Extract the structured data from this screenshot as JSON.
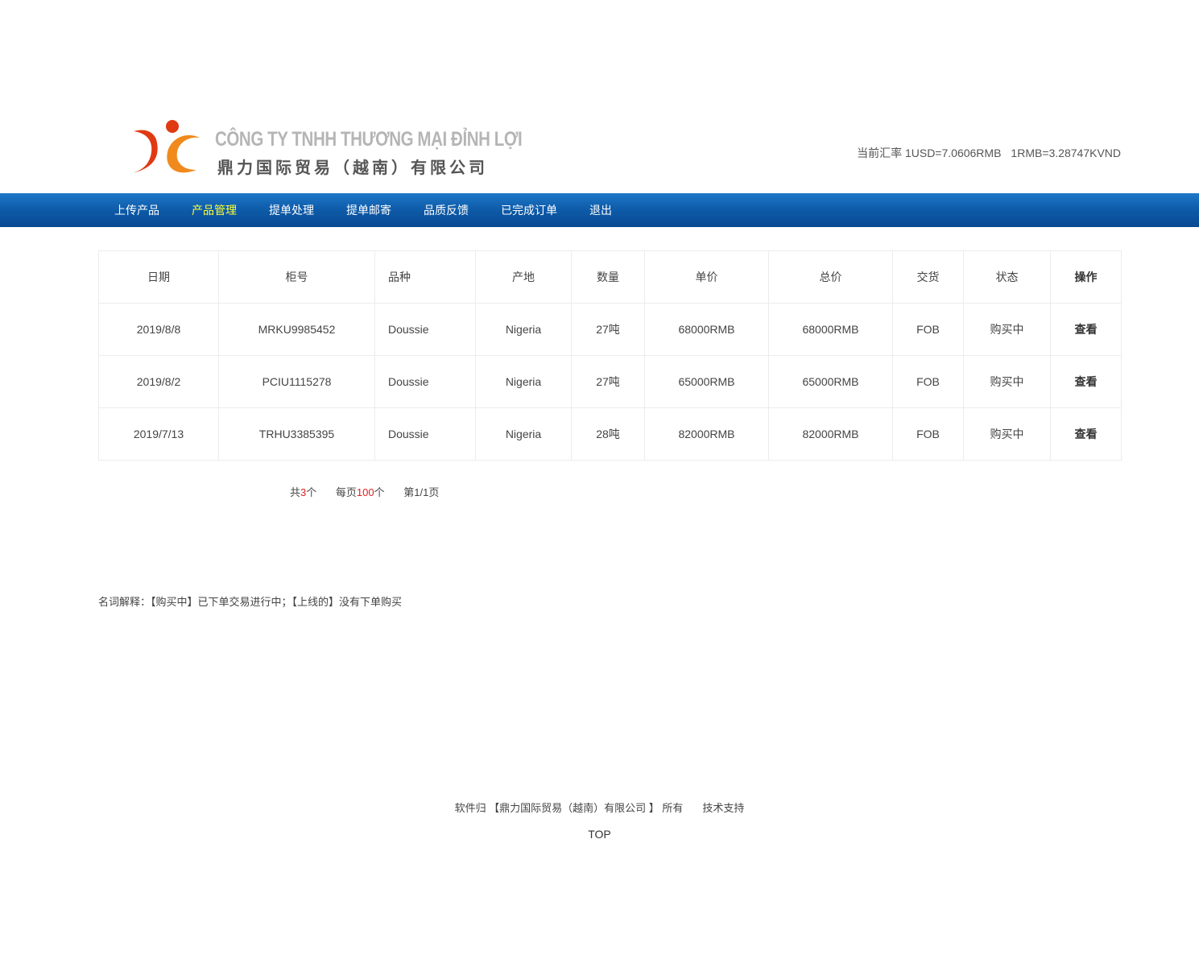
{
  "header": {
    "logo_en": "CÔNG TY TNHH THƯƠNG MẠI ĐỈNH LỢI",
    "logo_cn": "鼎力国际贸易（越南）有限公司",
    "rate_usd": "当前汇率 1USD=7.0606RMB",
    "rate_rmb": "1RMB=3.28747KVND"
  },
  "nav": {
    "items": [
      {
        "label": "上传产品"
      },
      {
        "label": "产品管理",
        "active": true
      },
      {
        "label": "提单处理"
      },
      {
        "label": "提单邮寄"
      },
      {
        "label": "品质反馈"
      },
      {
        "label": "已完成订单"
      },
      {
        "label": "退出"
      }
    ]
  },
  "table": {
    "headers": [
      "日期",
      "柜号",
      "品种",
      "产地",
      "数量",
      "单价",
      "总价",
      "交货",
      "状态",
      "操作"
    ],
    "rows": [
      {
        "date": "2019/8/8",
        "container": "MRKU9985452",
        "species": "Doussie",
        "origin": "Nigeria",
        "qty": "27吨",
        "unit_price": "68000RMB",
        "total": "68000RMB",
        "delivery": "FOB",
        "status": "购买中",
        "action": "查看"
      },
      {
        "date": "2019/8/2",
        "container": "PCIU1115278",
        "species": "Doussie",
        "origin": "Nigeria",
        "qty": "27吨",
        "unit_price": "65000RMB",
        "total": "65000RMB",
        "delivery": "FOB",
        "status": "购买中",
        "action": "查看"
      },
      {
        "date": "2019/7/13",
        "container": "TRHU3385395",
        "species": "Doussie",
        "origin": "Nigeria",
        "qty": "28吨",
        "unit_price": "82000RMB",
        "total": "82000RMB",
        "delivery": "FOB",
        "status": "购买中",
        "action": "查看"
      }
    ]
  },
  "pager": {
    "total_prefix": "共",
    "total_count": "3",
    "total_suffix": "个",
    "per_prefix": "每页",
    "per_count": "100",
    "per_suffix": "个",
    "page_text": "第1/1页"
  },
  "glossary": "名词解释：【购买中】已下单交易进行中；【上线的】没有下单购买",
  "footer": {
    "copyright": "软件归 【鼎力国际贸易（越南）有限公司 】 所有",
    "support": "技术支持",
    "top": "TOP"
  },
  "colors": {
    "nav_bg": "#0d5aa8",
    "nav_active": "#ffff33",
    "logo_orange": "#f08a1c",
    "logo_red": "#e03a12",
    "highlight_red": "#e02020"
  }
}
